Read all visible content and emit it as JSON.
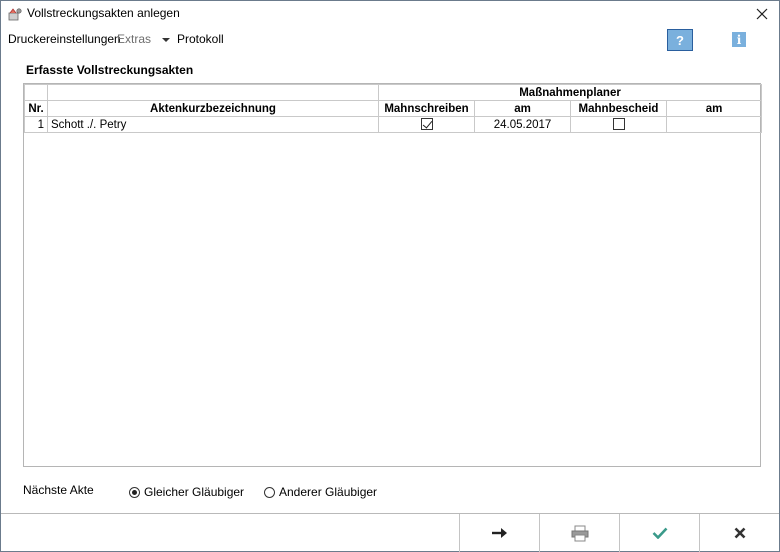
{
  "window": {
    "title": "Vollstreckungsakten anlegen",
    "close_icon": "close-icon"
  },
  "menu": {
    "druckereinstellungen": "Druckereinstellungen",
    "extras": "Extras",
    "protokoll": "Protokoll",
    "help_label": "?",
    "info_label": "i"
  },
  "section": {
    "title": "Erfasste Vollstreckungsakten"
  },
  "table": {
    "group_header": "Maßnahmenplaner",
    "columns": [
      "Nr.",
      "Aktenkurzbezeichnung",
      "Mahnschreiben",
      "am",
      "Mahnbescheid",
      "am"
    ],
    "rows": [
      {
        "nr": "1",
        "aktenkurzbezeichnung": "Schott ./. Petry",
        "mahnschreiben_checked": true,
        "mahnschreiben_am": "24.05.2017",
        "mahnbescheid_checked": false,
        "mahnbescheid_am": ""
      }
    ]
  },
  "next_file": {
    "label": "Nächste Akte",
    "options": [
      "Gleicher Gläubiger",
      "Anderer Gläubiger"
    ],
    "selected": "Gleicher Gläubiger"
  },
  "footer": {
    "buttons": [
      "arrow-right-icon",
      "printer-icon",
      "checkmark-icon",
      "cancel-icon"
    ],
    "colors": {
      "confirm": "#3a9a8a",
      "cancel": "#333333",
      "arrow": "#222222"
    }
  }
}
